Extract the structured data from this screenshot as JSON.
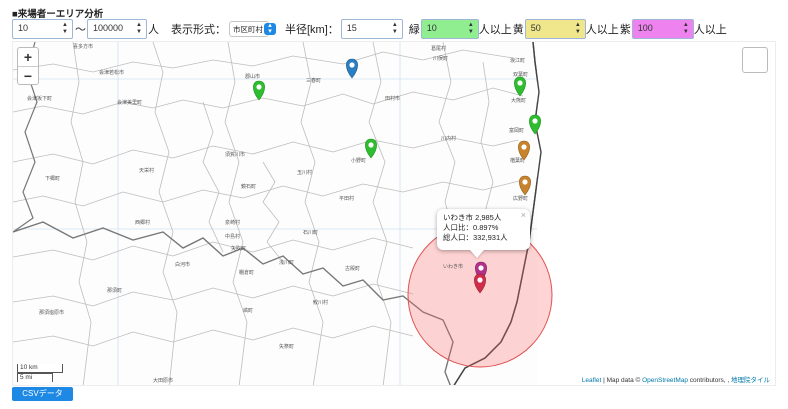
{
  "page": {
    "title": "■来場者ーエリア分析"
  },
  "controls": {
    "min_value": "10",
    "tilde": "〜",
    "max_value": "100000",
    "unit_people": "人",
    "display_format_label": "表示形式：",
    "display_format_value": "市区町村",
    "radius_label": "半径[km]：",
    "radius_value": "15",
    "green_label": "緑",
    "green_value": "10",
    "green_suffix": "人以上",
    "yellow_label": "黄",
    "yellow_value": "50",
    "yellow_suffix": "人以上",
    "purple_label": "紫",
    "purple_value": "100",
    "purple_suffix": "人以上",
    "green_color": "#90ee90",
    "yellow_color": "#f0e68c",
    "purple_color": "#ee82ee"
  },
  "map": {
    "zoom_in": "+",
    "zoom_out": "−",
    "popup": {
      "close": "×",
      "line1": "いわき市 2,985人",
      "line2": "人口比：0.897%",
      "line3": "総人口：332,931人"
    },
    "circle_label": "いわき市",
    "scale_km": "10 km",
    "scale_mi": "5 mi",
    "attribution": {
      "leaflet": "Leaflet",
      "text1": " | Map data © ",
      "osm": "OpenStreetMap",
      "text2": " contributors, , ",
      "gsi": "地理院タイル"
    },
    "place_labels": [
      "葛尾村",
      "浪江町",
      "喜多方市",
      "会津若松市",
      "三春町",
      "会津坂下町",
      "会津美里町",
      "郡山市",
      "田村市",
      "双葉町",
      "大熊町",
      "富岡町",
      "川内村",
      "楢葉町",
      "小野町",
      "須賀川市",
      "天栄村",
      "下郷町",
      "鏡石町",
      "玉川村",
      "平田村",
      "広野町",
      "西郷村",
      "泉崎村",
      "石川町",
      "中島村",
      "古殿町",
      "白河市",
      "棚倉町",
      "浅川町",
      "鮫川村",
      "塙町",
      "矢祭町",
      "大田原市",
      "那須塩原市",
      "那須町",
      "矢吹町",
      "川俣町"
    ],
    "marker_colors": {
      "green": "#2ebd2e",
      "blue": "#2a7fc4",
      "orange": "#c8842c",
      "purple": "#b0308a",
      "red": "#d12c4a"
    },
    "circle_color": "#ff6666"
  },
  "footer": {
    "csv_button": "CSVデータ"
  }
}
